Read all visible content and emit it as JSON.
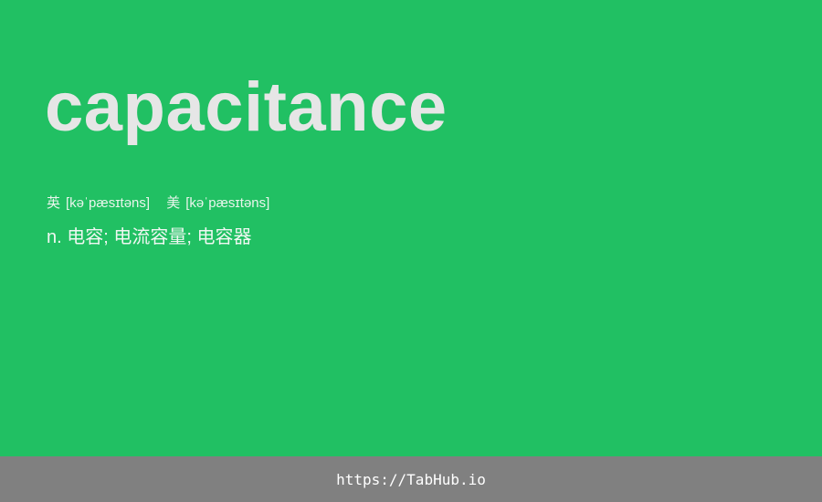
{
  "card": {
    "word": "capacitance",
    "phonetics": {
      "uk": {
        "region": "英",
        "ipa": "[kəˈpæsɪtəns]"
      },
      "us": {
        "region": "美",
        "ipa": "[kəˈpæsɪtəns]"
      }
    },
    "definition": "n. 电容; 电流容量; 电容器"
  },
  "footer": {
    "link_text": "https://TabHub.io"
  },
  "colors": {
    "background": "#21c063",
    "word": "#e6e6e6",
    "footer_bar": "#808080",
    "footer_text": "#ffffff"
  }
}
